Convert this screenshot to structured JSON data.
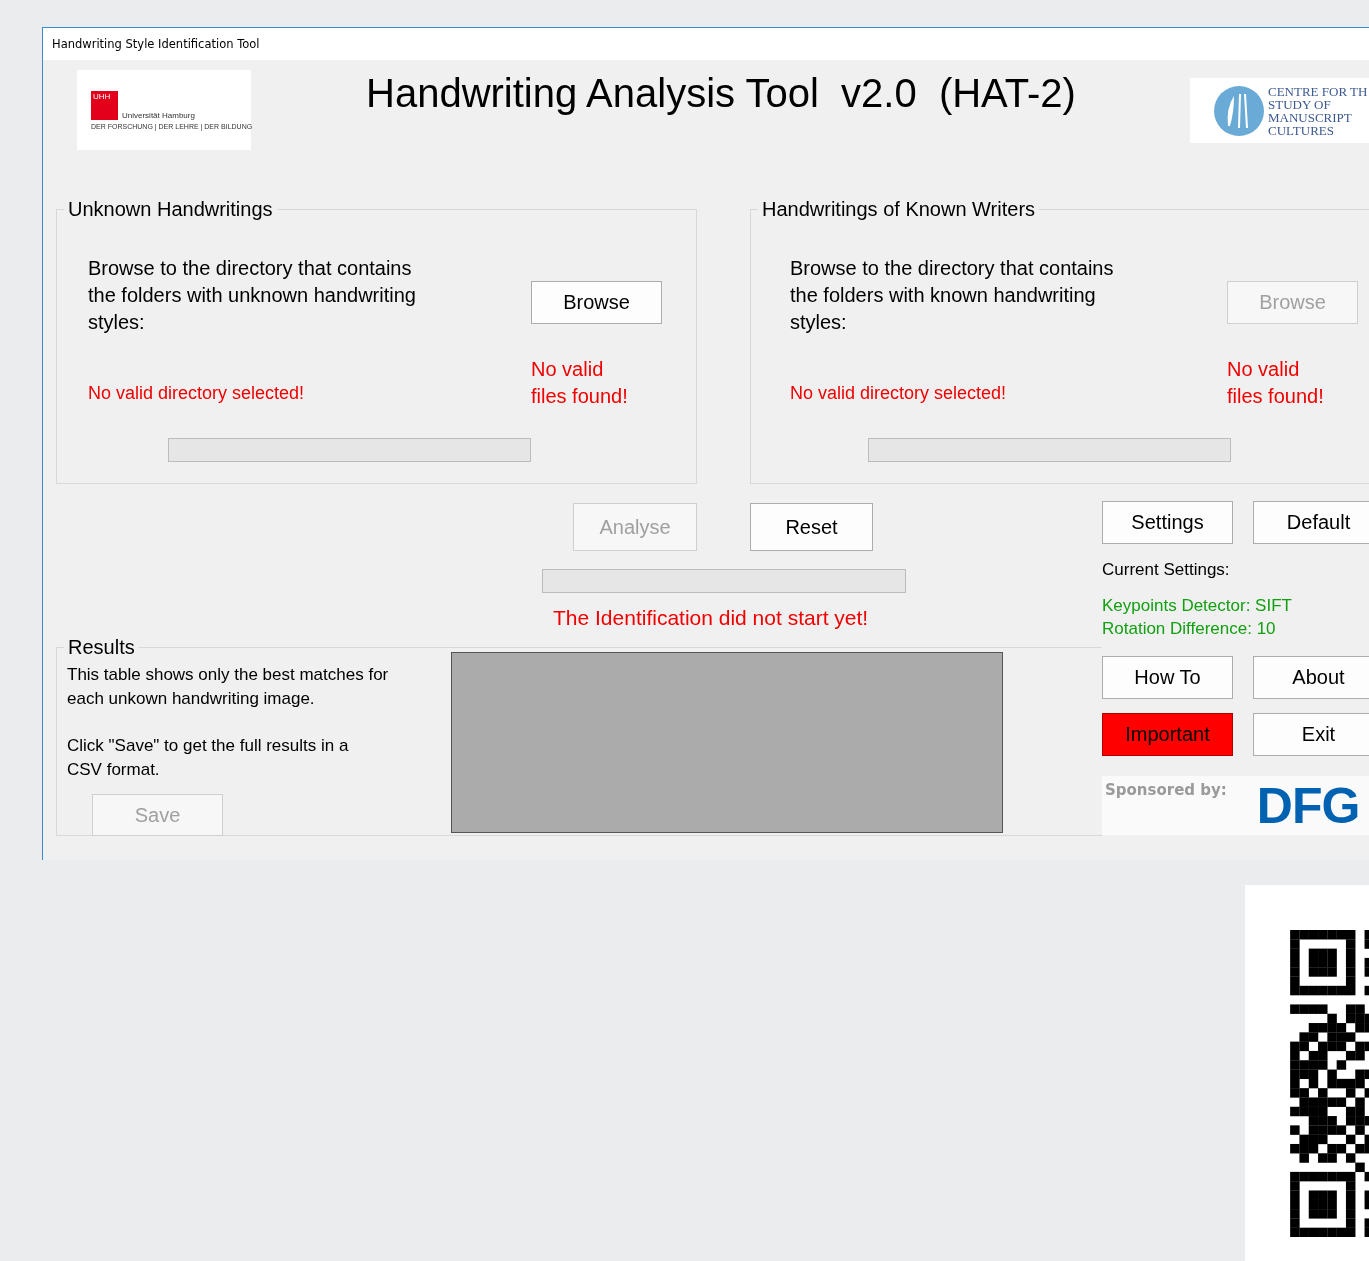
{
  "window": {
    "title": "Handwriting Style Identification Tool"
  },
  "header": {
    "title": "Handwriting Analysis Tool  v2.0  (HAT-2)",
    "left_logo": {
      "mark": "UHH",
      "name": "Universität Hamburg",
      "tagline": "DER FORSCHUNG | DER LEHRE | DER BILDUNG"
    },
    "right_logo": {
      "lines": [
        "CENTRE FOR TH",
        "STUDY OF",
        "MANUSCRIPT",
        "CULTURES"
      ]
    }
  },
  "groups": [
    {
      "title": "Unknown Handwritings",
      "instruction": "Browse to the directory that contains\nthe folders with unknown handwriting\nstyles:",
      "browse_button": {
        "label": "Browse",
        "disabled": false
      },
      "directory_status": "No valid directory selected!",
      "files_status": "No valid\nfiles found!",
      "progress": {
        "level": 0
      }
    },
    {
      "title": "Handwritings of Known Writers",
      "instruction": "Browse to the directory that contains\nthe folders with known handwriting\nstyles:",
      "browse_button": {
        "label": "Browse",
        "disabled": true
      },
      "directory_status": "No valid directory selected!",
      "files_status": "No valid\nfiles found!",
      "progress": {
        "level": 0
      }
    }
  ],
  "actions": {
    "analyse_button": {
      "label": "Analyse",
      "disabled": true
    },
    "reset_button": {
      "label": "Reset",
      "disabled": false
    },
    "progress": {
      "level": 0
    },
    "status": "The Identification did not start yet!"
  },
  "settings": {
    "buttons": [
      {
        "label": "Settings",
        "kind": "normal"
      },
      {
        "label": "Default",
        "kind": "normal"
      }
    ],
    "current_label": "Current Settings:",
    "current": [
      "Keypoints Detector: SIFT",
      "Rotation Difference: 10"
    ]
  },
  "results": {
    "title": "Results",
    "description": "This table shows only the best matches for\neach unkown handwriting image.",
    "save_hint": "Click \"Save\" to get the full results in a\nCSV format.",
    "save_button": {
      "label": "Save",
      "disabled": true
    }
  },
  "menu_buttons": [
    {
      "label": "How To",
      "kind": "normal"
    },
    {
      "label": "About",
      "kind": "normal"
    },
    {
      "label": "Important",
      "kind": "alert"
    },
    {
      "label": "Exit",
      "kind": "normal"
    }
  ],
  "sponsor": {
    "label": "Sponsored by:",
    "logo": "DFG"
  }
}
